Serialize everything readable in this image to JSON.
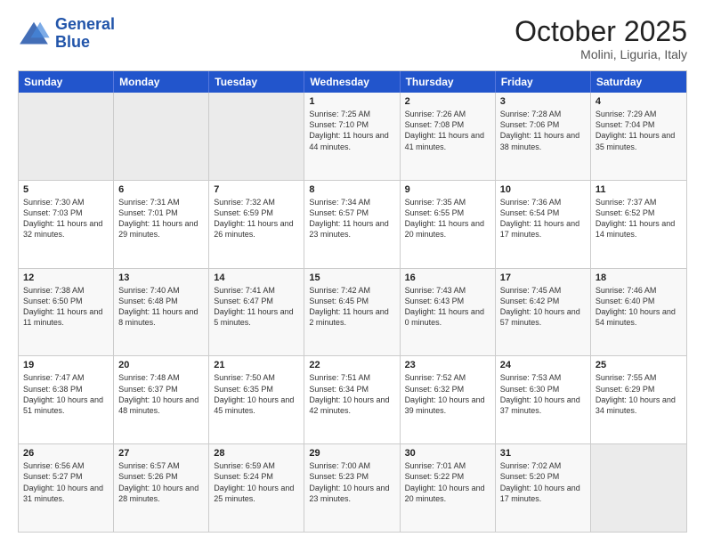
{
  "header": {
    "logo_line1": "General",
    "logo_line2": "Blue",
    "month": "October 2025",
    "location": "Molini, Liguria, Italy"
  },
  "days_of_week": [
    "Sunday",
    "Monday",
    "Tuesday",
    "Wednesday",
    "Thursday",
    "Friday",
    "Saturday"
  ],
  "weeks": [
    [
      {
        "day": "",
        "info": ""
      },
      {
        "day": "",
        "info": ""
      },
      {
        "day": "",
        "info": ""
      },
      {
        "day": "1",
        "info": "Sunrise: 7:25 AM\nSunset: 7:10 PM\nDaylight: 11 hours\nand 44 minutes."
      },
      {
        "day": "2",
        "info": "Sunrise: 7:26 AM\nSunset: 7:08 PM\nDaylight: 11 hours\nand 41 minutes."
      },
      {
        "day": "3",
        "info": "Sunrise: 7:28 AM\nSunset: 7:06 PM\nDaylight: 11 hours\nand 38 minutes."
      },
      {
        "day": "4",
        "info": "Sunrise: 7:29 AM\nSunset: 7:04 PM\nDaylight: 11 hours\nand 35 minutes."
      }
    ],
    [
      {
        "day": "5",
        "info": "Sunrise: 7:30 AM\nSunset: 7:03 PM\nDaylight: 11 hours\nand 32 minutes."
      },
      {
        "day": "6",
        "info": "Sunrise: 7:31 AM\nSunset: 7:01 PM\nDaylight: 11 hours\nand 29 minutes."
      },
      {
        "day": "7",
        "info": "Sunrise: 7:32 AM\nSunset: 6:59 PM\nDaylight: 11 hours\nand 26 minutes."
      },
      {
        "day": "8",
        "info": "Sunrise: 7:34 AM\nSunset: 6:57 PM\nDaylight: 11 hours\nand 23 minutes."
      },
      {
        "day": "9",
        "info": "Sunrise: 7:35 AM\nSunset: 6:55 PM\nDaylight: 11 hours\nand 20 minutes."
      },
      {
        "day": "10",
        "info": "Sunrise: 7:36 AM\nSunset: 6:54 PM\nDaylight: 11 hours\nand 17 minutes."
      },
      {
        "day": "11",
        "info": "Sunrise: 7:37 AM\nSunset: 6:52 PM\nDaylight: 11 hours\nand 14 minutes."
      }
    ],
    [
      {
        "day": "12",
        "info": "Sunrise: 7:38 AM\nSunset: 6:50 PM\nDaylight: 11 hours\nand 11 minutes."
      },
      {
        "day": "13",
        "info": "Sunrise: 7:40 AM\nSunset: 6:48 PM\nDaylight: 11 hours\nand 8 minutes."
      },
      {
        "day": "14",
        "info": "Sunrise: 7:41 AM\nSunset: 6:47 PM\nDaylight: 11 hours\nand 5 minutes."
      },
      {
        "day": "15",
        "info": "Sunrise: 7:42 AM\nSunset: 6:45 PM\nDaylight: 11 hours\nand 2 minutes."
      },
      {
        "day": "16",
        "info": "Sunrise: 7:43 AM\nSunset: 6:43 PM\nDaylight: 11 hours\nand 0 minutes."
      },
      {
        "day": "17",
        "info": "Sunrise: 7:45 AM\nSunset: 6:42 PM\nDaylight: 10 hours\nand 57 minutes."
      },
      {
        "day": "18",
        "info": "Sunrise: 7:46 AM\nSunset: 6:40 PM\nDaylight: 10 hours\nand 54 minutes."
      }
    ],
    [
      {
        "day": "19",
        "info": "Sunrise: 7:47 AM\nSunset: 6:38 PM\nDaylight: 10 hours\nand 51 minutes."
      },
      {
        "day": "20",
        "info": "Sunrise: 7:48 AM\nSunset: 6:37 PM\nDaylight: 10 hours\nand 48 minutes."
      },
      {
        "day": "21",
        "info": "Sunrise: 7:50 AM\nSunset: 6:35 PM\nDaylight: 10 hours\nand 45 minutes."
      },
      {
        "day": "22",
        "info": "Sunrise: 7:51 AM\nSunset: 6:34 PM\nDaylight: 10 hours\nand 42 minutes."
      },
      {
        "day": "23",
        "info": "Sunrise: 7:52 AM\nSunset: 6:32 PM\nDaylight: 10 hours\nand 39 minutes."
      },
      {
        "day": "24",
        "info": "Sunrise: 7:53 AM\nSunset: 6:30 PM\nDaylight: 10 hours\nand 37 minutes."
      },
      {
        "day": "25",
        "info": "Sunrise: 7:55 AM\nSunset: 6:29 PM\nDaylight: 10 hours\nand 34 minutes."
      }
    ],
    [
      {
        "day": "26",
        "info": "Sunrise: 6:56 AM\nSunset: 5:27 PM\nDaylight: 10 hours\nand 31 minutes."
      },
      {
        "day": "27",
        "info": "Sunrise: 6:57 AM\nSunset: 5:26 PM\nDaylight: 10 hours\nand 28 minutes."
      },
      {
        "day": "28",
        "info": "Sunrise: 6:59 AM\nSunset: 5:24 PM\nDaylight: 10 hours\nand 25 minutes."
      },
      {
        "day": "29",
        "info": "Sunrise: 7:00 AM\nSunset: 5:23 PM\nDaylight: 10 hours\nand 23 minutes."
      },
      {
        "day": "30",
        "info": "Sunrise: 7:01 AM\nSunset: 5:22 PM\nDaylight: 10 hours\nand 20 minutes."
      },
      {
        "day": "31",
        "info": "Sunrise: 7:02 AM\nSunset: 5:20 PM\nDaylight: 10 hours\nand 17 minutes."
      },
      {
        "day": "",
        "info": ""
      }
    ]
  ]
}
